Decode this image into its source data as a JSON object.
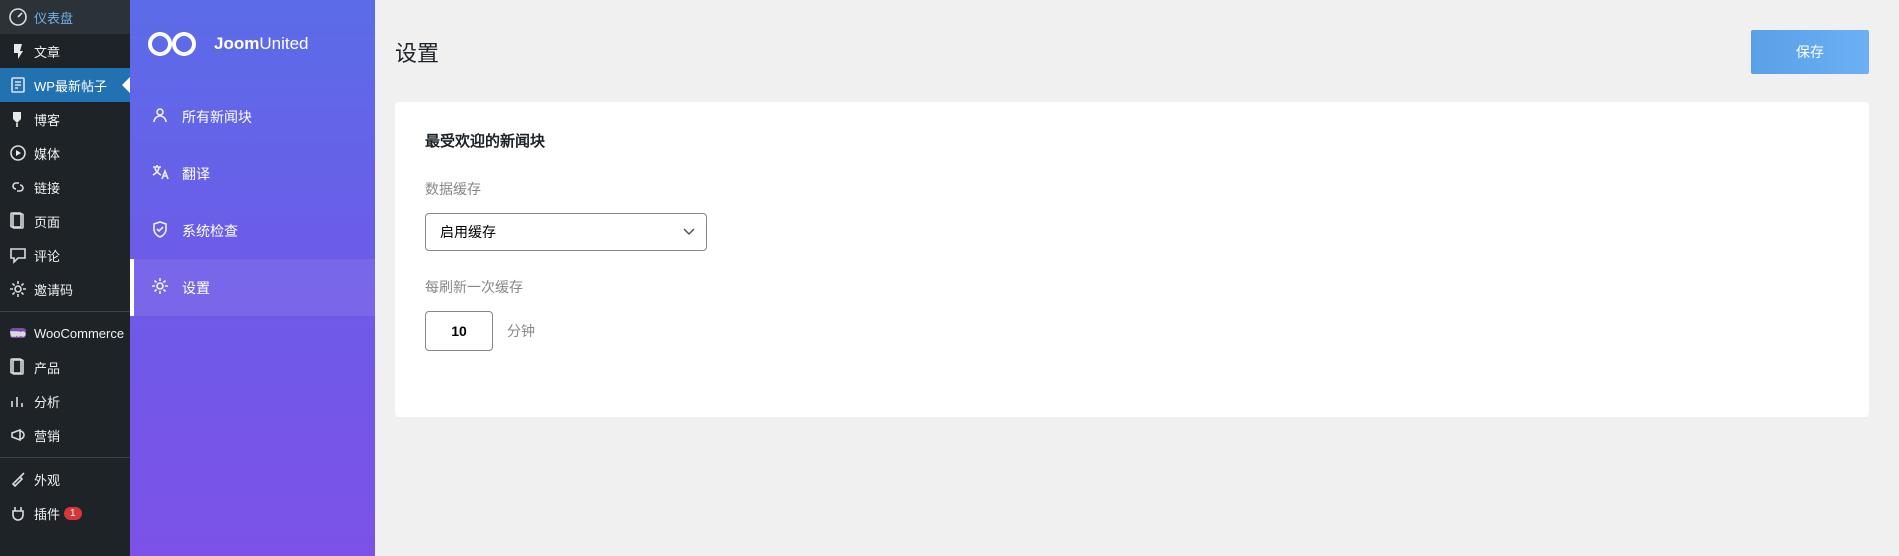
{
  "wp_sidebar": [
    {
      "label": "仪表盘",
      "icon": "dashboard"
    },
    {
      "label": "文章",
      "icon": "pin"
    },
    {
      "label": "WP最新帖子",
      "icon": "post",
      "active": true
    },
    {
      "label": "博客",
      "icon": "pin2"
    },
    {
      "label": "媒体",
      "icon": "media"
    },
    {
      "label": "链接",
      "icon": "link"
    },
    {
      "label": "页面",
      "icon": "page"
    },
    {
      "label": "评论",
      "icon": "comment"
    },
    {
      "label": "邀请码",
      "icon": "gear"
    },
    {
      "label": "WooCommerce",
      "icon": "woo",
      "sep_before": true
    },
    {
      "label": "产品",
      "icon": "page"
    },
    {
      "label": "分析",
      "icon": "analytics"
    },
    {
      "label": "营销",
      "icon": "megaphone"
    },
    {
      "label": "外观",
      "icon": "brush",
      "sep_before": true
    },
    {
      "label": "插件",
      "icon": "plugin",
      "badge": "1"
    }
  ],
  "ju_brand": "JoomUnited",
  "ju_menu": [
    {
      "label": "所有新闻块",
      "icon": "user"
    },
    {
      "label": "翻译",
      "icon": "translate"
    },
    {
      "label": "系统检查",
      "icon": "shield"
    },
    {
      "label": "设置",
      "icon": "gear",
      "active": true
    }
  ],
  "header": {
    "title": "设置",
    "save": "保存"
  },
  "card": {
    "title": "最受欢迎的新闻块",
    "cache_label": "数据缓存",
    "cache_value": "启用缓存",
    "refresh_label": "每刷新一次缓存",
    "refresh_value": "10",
    "refresh_unit": "分钟"
  }
}
